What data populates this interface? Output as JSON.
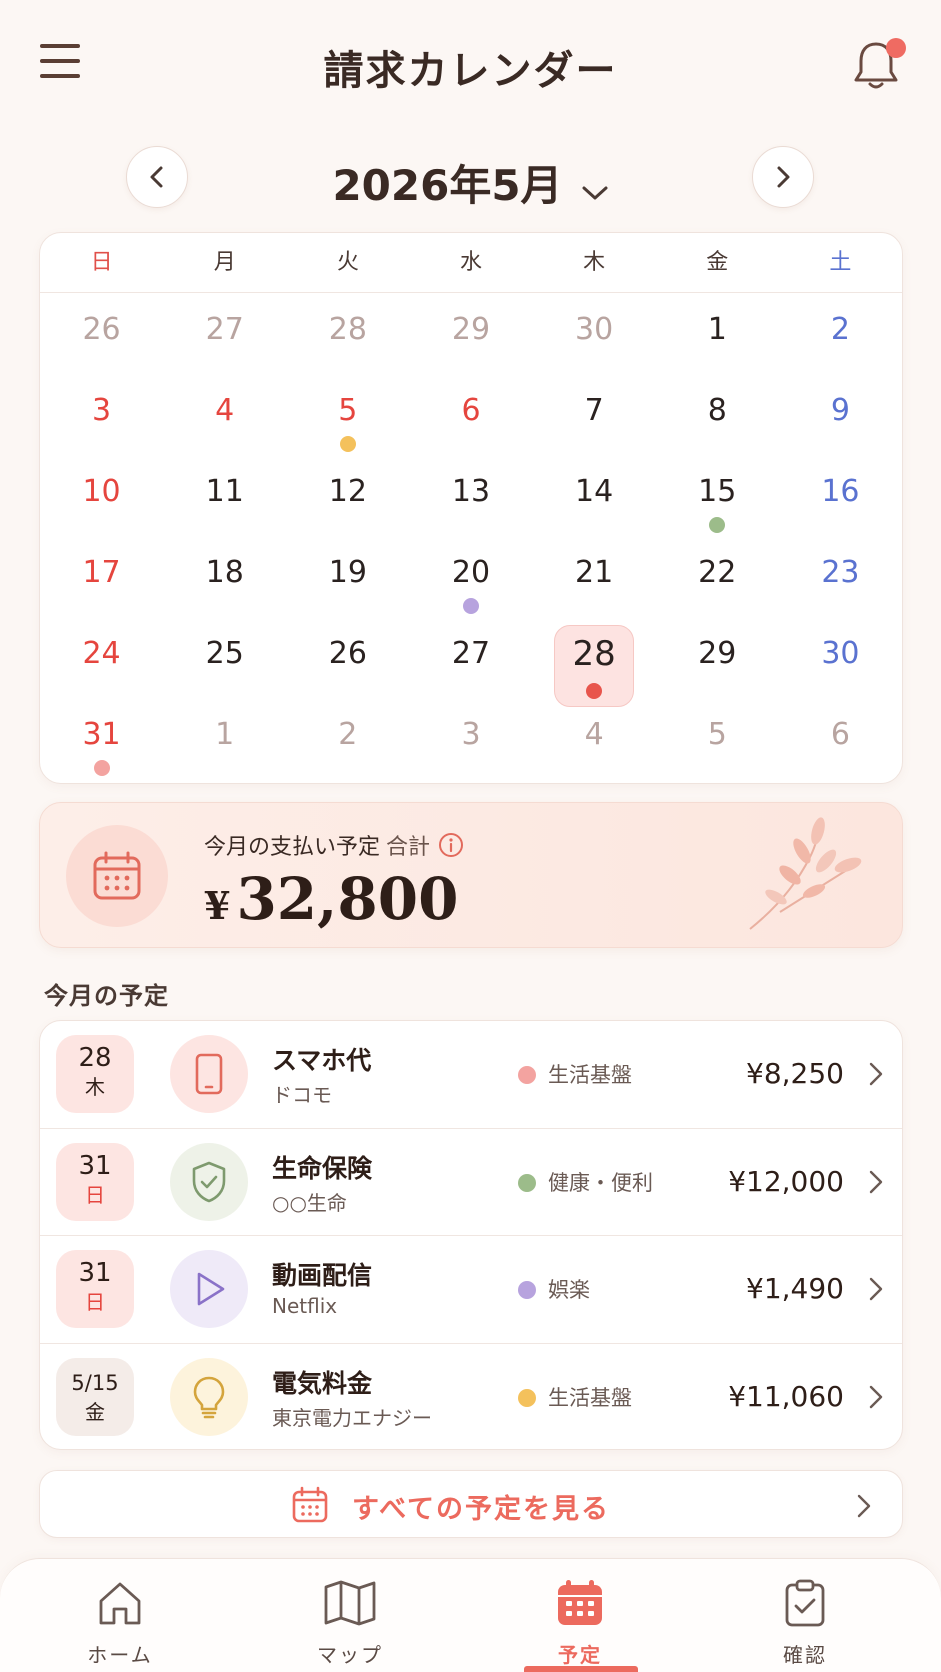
{
  "header": {
    "title": "請求カレンダー"
  },
  "month_nav": {
    "label": "2026年5月"
  },
  "calendar": {
    "weekdays": [
      "日",
      "月",
      "火",
      "水",
      "木",
      "金",
      "土"
    ],
    "days": [
      {
        "label": "26",
        "type": "other"
      },
      {
        "label": "27",
        "type": "other"
      },
      {
        "label": "28",
        "type": "other"
      },
      {
        "label": "29",
        "type": "other"
      },
      {
        "label": "30",
        "type": "other"
      },
      {
        "label": "1",
        "type": "normal"
      },
      {
        "label": "2",
        "type": "sat"
      },
      {
        "label": "3",
        "type": "sun"
      },
      {
        "label": "4",
        "type": "sun"
      },
      {
        "label": "5",
        "type": "sun",
        "dot": "#f4c15c"
      },
      {
        "label": "6",
        "type": "sun"
      },
      {
        "label": "7",
        "type": "normal"
      },
      {
        "label": "8",
        "type": "normal"
      },
      {
        "label": "9",
        "type": "sat"
      },
      {
        "label": "10",
        "type": "sun"
      },
      {
        "label": "11",
        "type": "normal"
      },
      {
        "label": "12",
        "type": "normal"
      },
      {
        "label": "13",
        "type": "normal"
      },
      {
        "label": "14",
        "type": "normal"
      },
      {
        "label": "15",
        "type": "normal",
        "dot": "#9cbc8a"
      },
      {
        "label": "16",
        "type": "sat"
      },
      {
        "label": "17",
        "type": "sun"
      },
      {
        "label": "18",
        "type": "normal"
      },
      {
        "label": "19",
        "type": "normal"
      },
      {
        "label": "20",
        "type": "normal",
        "dot": "#b7a3de"
      },
      {
        "label": "21",
        "type": "normal"
      },
      {
        "label": "22",
        "type": "normal"
      },
      {
        "label": "23",
        "type": "sat"
      },
      {
        "label": "24",
        "type": "sun"
      },
      {
        "label": "25",
        "type": "normal"
      },
      {
        "label": "26",
        "type": "normal"
      },
      {
        "label": "27",
        "type": "normal"
      },
      {
        "label": "28",
        "type": "today",
        "dot": "#e8554c"
      },
      {
        "label": "29",
        "type": "normal"
      },
      {
        "label": "30",
        "type": "sat"
      },
      {
        "label": "31",
        "type": "sun",
        "dot": "#f3a3a0"
      },
      {
        "label": "1",
        "type": "other"
      },
      {
        "label": "2",
        "type": "other"
      },
      {
        "label": "3",
        "type": "other"
      },
      {
        "label": "4",
        "type": "other"
      },
      {
        "label": "5",
        "type": "other"
      },
      {
        "label": "6",
        "type": "other"
      }
    ]
  },
  "summary": {
    "label": "今月の支払い予定",
    "sub_label": "合計",
    "currency": "¥",
    "amount": "32,800"
  },
  "schedule": {
    "title": "今月の予定",
    "items": [
      {
        "day": "28",
        "weekday": "木",
        "weekday_type": "normal",
        "badge": "pink",
        "icon": "smartphone-icon",
        "icon_bg": "#fde5e2",
        "name": "スマホ代",
        "sub": "ドコモ",
        "category": "生活基盤",
        "category_color": "#f3a3a0",
        "amount": "¥8,250"
      },
      {
        "day": "31",
        "weekday": "日",
        "weekday_type": "sun",
        "badge": "pink",
        "icon": "shield-icon",
        "icon_bg": "#eef2e8",
        "name": "生命保険",
        "sub": "○○生命",
        "category": "健康・便利",
        "category_color": "#9cbc8a",
        "amount": "¥12,000"
      },
      {
        "day": "31",
        "weekday": "日",
        "weekday_type": "sun",
        "badge": "pink",
        "icon": "play-icon",
        "icon_bg": "#efeaf8",
        "name": "動画配信",
        "sub": "Netflix",
        "category": "娯楽",
        "category_color": "#b7a3de",
        "amount": "¥1,490"
      },
      {
        "day": "5/15",
        "weekday": "金",
        "weekday_type": "normal",
        "badge": "neutral",
        "icon": "lightbulb-icon",
        "icon_bg": "#fdf3dc",
        "name": "電気料金",
        "sub": "東京電力エナジー",
        "category": "生活基盤",
        "category_color": "#f4c15c",
        "amount": "¥11,060"
      }
    ]
  },
  "view_all": {
    "label": "すべての予定を見る"
  },
  "bottom_nav": {
    "tabs": [
      {
        "label": "ホーム",
        "icon": "home-icon"
      },
      {
        "label": "マップ",
        "icon": "map-icon"
      },
      {
        "label": "予定",
        "icon": "calendar-icon",
        "active": true
      },
      {
        "label": "確認",
        "icon": "clipboard-check-icon"
      }
    ]
  },
  "colors": {
    "accent": "#ec6a5e",
    "background": "#fcf7f4",
    "sunday": "#e5453e",
    "saturday": "#5a72d0"
  }
}
